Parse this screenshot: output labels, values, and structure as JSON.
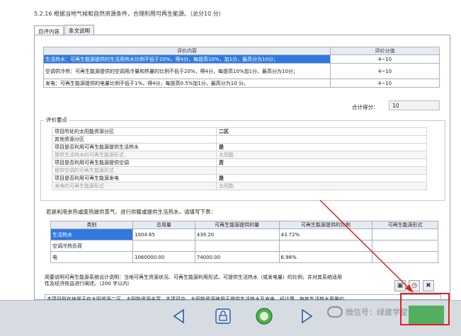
{
  "heading": "5.2.16 根据当地气候和自然资源条件，合理利用可再生能源。（总分10 分）",
  "tabs": [
    {
      "label": "自评内容",
      "active": true
    },
    {
      "label": "条文说明",
      "active": false
    }
  ],
  "score_table": {
    "headers": [
      "评价内容",
      "评价分值"
    ],
    "rows": [
      {
        "content": "生活热水：可再生能源提供的生活用热水比例不低于20%，得4分，每提高10%，加1分，最高分为10分；",
        "value": "4~10",
        "selected": true
      },
      {
        "content": "空调供冷热：可再生能源提供的空调用冷量和热量的比例不低于20%，得4分，每提高10%加1分，最高分为10分；",
        "value": "4~10",
        "selected": false
      },
      {
        "content": "发电：可再生能源提供的电量比例不低于1%，得4分，每提高0.5%加1分，最高分为10 分。",
        "value": "4~10",
        "selected": false
      }
    ]
  },
  "total": {
    "label": "合计得分：",
    "value": "10"
  },
  "factors": {
    "legend": "评价要点",
    "rows": [
      {
        "q": "项目所处的太阳能资源分区",
        "a": "二区",
        "sub": false
      },
      {
        "q": "其他资源分区",
        "a": "",
        "sub": false
      },
      {
        "q": "项目是否利用可再生能源提供生活热水",
        "a": "是",
        "sub": false
      },
      {
        "q": "提供生活热水的可再生能源形式",
        "a": "太阳能",
        "sub": true
      },
      {
        "q": "项目是否利用可再生能源提供空调",
        "a": "否",
        "sub": false
      },
      {
        "q": "提供空调的可再生能源形式",
        "a": "",
        "sub": true
      },
      {
        "q": "项目是否利用可再生能源发电",
        "a": "是",
        "sub": false
      },
      {
        "q": "发电的可再生能源形式",
        "a": "太阳能",
        "sub": true
      }
    ]
  },
  "prompt": "若是利用余热或废热提供蒸气、进行供暖或提供生活热水，请填写下表：",
  "heat_table": {
    "headers": [
      "类别",
      "总用量",
      "可再生能源提供的量",
      "可再生能源提供的比例",
      "可再生能源形式"
    ],
    "rows": [
      {
        "cells": [
          "生活热水",
          "1004.65",
          "439.20",
          "43.72%",
          ""
        ],
        "selected": true
      },
      {
        "cells": [
          "空调冷热负荷",
          "",
          "",
          "",
          ""
        ],
        "selected": false
      },
      {
        "cells": [
          "电",
          "1060000.00",
          "74000.00",
          "6.98%",
          ""
        ],
        "selected": false
      }
    ]
  },
  "desc_label": "简要说明可再生能源系统设计说明：当地可再生资源状况、可再生能源利用形式、可提供生活热水（或发电量）的比例，并对其系统适用性及经济效益进行阐述。（200 字以内）",
  "desc_text": "本项目所在地属于在太阳资源二区，太阳能资源丰富。本项目中，太阳能资源被用于提供生活热水及发电。经计算，每年生活热水用量约",
  "watermark": "微信号：绿建学堂",
  "colors": {
    "selection": "#2f7ae0",
    "highlight_box": "#e02020",
    "arrow": "#e02020"
  },
  "icons": {
    "back": "arrow-left-icon",
    "lock": "lock-icon",
    "home": "circle-icon",
    "forward": "arrow-right-icon"
  }
}
